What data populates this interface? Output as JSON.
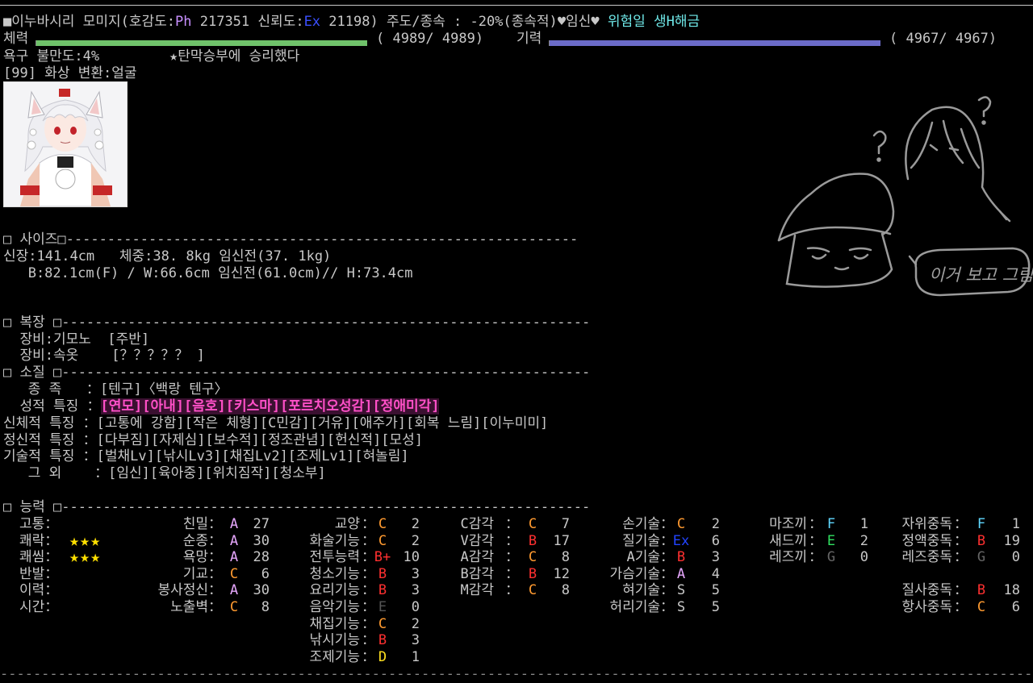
{
  "header": {
    "bullet": "■",
    "name": "이누바시리 모미지",
    "affection_prefix": "(호감도:",
    "affection_grade": "Ph",
    "affection_value": "217351",
    "trust_prefix": "신뢰도:",
    "trust_grade": "Ex",
    "trust_value": "21198)",
    "lead_text": "주도/종속 : -20%(종속적)",
    "pregnant": "♥임신♥",
    "danger": "위험일 생H해금"
  },
  "vitals": {
    "hp_label": "체력",
    "hp_text": "( 4989/ 4989)",
    "hp_fraction": 1.0,
    "hp_color": "#6fc26a",
    "sp_label": "기력",
    "sp_text": "( 4967/ 4967)",
    "sp_fraction": 1.0,
    "sp_color": "#6b6bc8",
    "desire": "욕구 불만도:4%",
    "achievement": "★탄막승부에 승리했다",
    "transform": "[99] 화상 변환:얼굴"
  },
  "size": {
    "header": "□ 사이즈□--------------------------------------------------------------",
    "line1": "신장:141.4cm   체중:38. 8kg 임신전(37. 1kg)",
    "line2": "   B:82.1cm(F) / W:66.6cm 임신전(61.0cm)// H:73.4cm"
  },
  "clothes": {
    "header": "□ 복장 □----------------------------------------------------------------",
    "line1": "  장비:기모노  [주반]",
    "line2": "  장비:속옷    [？？？？？ ]"
  },
  "traits": {
    "header": "□ 소질 □----------------------------------------------------------------",
    "race_label": "   종 족   ：",
    "race_value": "[텐구]〈백랑 텐구〉",
    "sexual_label": "  성적 특징 ：",
    "sexual_value": "[연모][아내][음호][키스마][포르치오성감][정애미각]",
    "body_label": "신체적 특징 ：",
    "body_value": "[고통에 강함][작은 체형][C민감][거유][애주가][회복 느림][이누미미]",
    "mental_label": "정신적 특징 ：",
    "mental_value": "[다부짐][자제심][보수적][정조관념][헌신적][모성]",
    "skill_label": "기술적 특징 ：",
    "skill_value": "[벌채Lv][낚시Lv3][채집Lv2][조제Lv1][혀놀림]",
    "other_label": "   그 외    ：",
    "other_value": "[임신][육아중][위치짐작][청소부]"
  },
  "abilities": {
    "header": "□ 능력 □----------------------------------------------------------------",
    "left_labels": [
      "고통：",
      "쾌락：",
      "쾌씸：",
      "반발：",
      "이력：",
      "시간："
    ],
    "stars": [
      "",
      "★★★",
      "★★★",
      "",
      "",
      ""
    ],
    "col1": [
      {
        "label": "친밀",
        "grade": "A",
        "value": "27"
      },
      {
        "label": "순종",
        "grade": "A",
        "value": "30"
      },
      {
        "label": "욕망",
        "grade": "A",
        "value": "28"
      },
      {
        "label": "기교",
        "grade": "C",
        "value": "6"
      },
      {
        "label": "봉사정신",
        "grade": "A",
        "value": "30"
      },
      {
        "label": "노출벽",
        "grade": "C",
        "value": "8"
      }
    ],
    "col2": [
      {
        "label": "교양",
        "grade": "C",
        "value": "2"
      },
      {
        "label": "화술기능",
        "grade": "C",
        "value": "2"
      },
      {
        "label": "전투능력",
        "grade": "B+",
        "value": "10"
      },
      {
        "label": "청소기능",
        "grade": "B",
        "value": "3"
      },
      {
        "label": "요리기능",
        "grade": "B",
        "value": "3"
      },
      {
        "label": "음악기능",
        "grade": "E",
        "value": "0"
      },
      {
        "label": "채집기능",
        "grade": "C",
        "value": "2"
      },
      {
        "label": "낚시기능",
        "grade": "B",
        "value": "3"
      },
      {
        "label": "조제기능",
        "grade": "D",
        "value": "1"
      }
    ],
    "col3": [
      {
        "label": "C감각",
        "grade": "C",
        "value": "7"
      },
      {
        "label": "V감각",
        "grade": "B",
        "value": "17"
      },
      {
        "label": "A감각",
        "grade": "C",
        "value": "8"
      },
      {
        "label": "B감각",
        "grade": "B",
        "value": "12"
      },
      {
        "label": "M감각",
        "grade": "C",
        "value": "8"
      }
    ],
    "col4": [
      {
        "label": "손기술",
        "grade": "C",
        "value": "2"
      },
      {
        "label": "질기술",
        "grade": "Ex",
        "value": "6"
      },
      {
        "label": "A기술",
        "grade": "B",
        "value": "3"
      },
      {
        "label": "가슴기술",
        "grade": "A",
        "value": "4"
      },
      {
        "label": "혀기술",
        "grade": "S",
        "value": "5"
      },
      {
        "label": "허리기술",
        "grade": "S",
        "value": "5"
      }
    ],
    "col5": [
      {
        "label": "마조끼",
        "grade": "F",
        "value": "1"
      },
      {
        "label": "새드끼",
        "grade": "E",
        "value": "2"
      },
      {
        "label": "레즈끼",
        "grade": "G",
        "value": "0"
      }
    ],
    "col6": [
      {
        "label": "자위중독",
        "grade": "F",
        "value": "1"
      },
      {
        "label": "정액중독",
        "grade": "B",
        "value": "19"
      },
      {
        "label": "레즈중독",
        "grade": "G",
        "value": "0"
      },
      {
        "label": "",
        "grade": "",
        "value": ""
      },
      {
        "label": "질사중독",
        "grade": "B",
        "value": "18"
      },
      {
        "label": "항사중독",
        "grade": "C",
        "value": "6"
      }
    ]
  },
  "sketch_note": "이거 보고 그림",
  "footer_dash": "--------------------------------------------------------------------------------------------------------------------------------"
}
